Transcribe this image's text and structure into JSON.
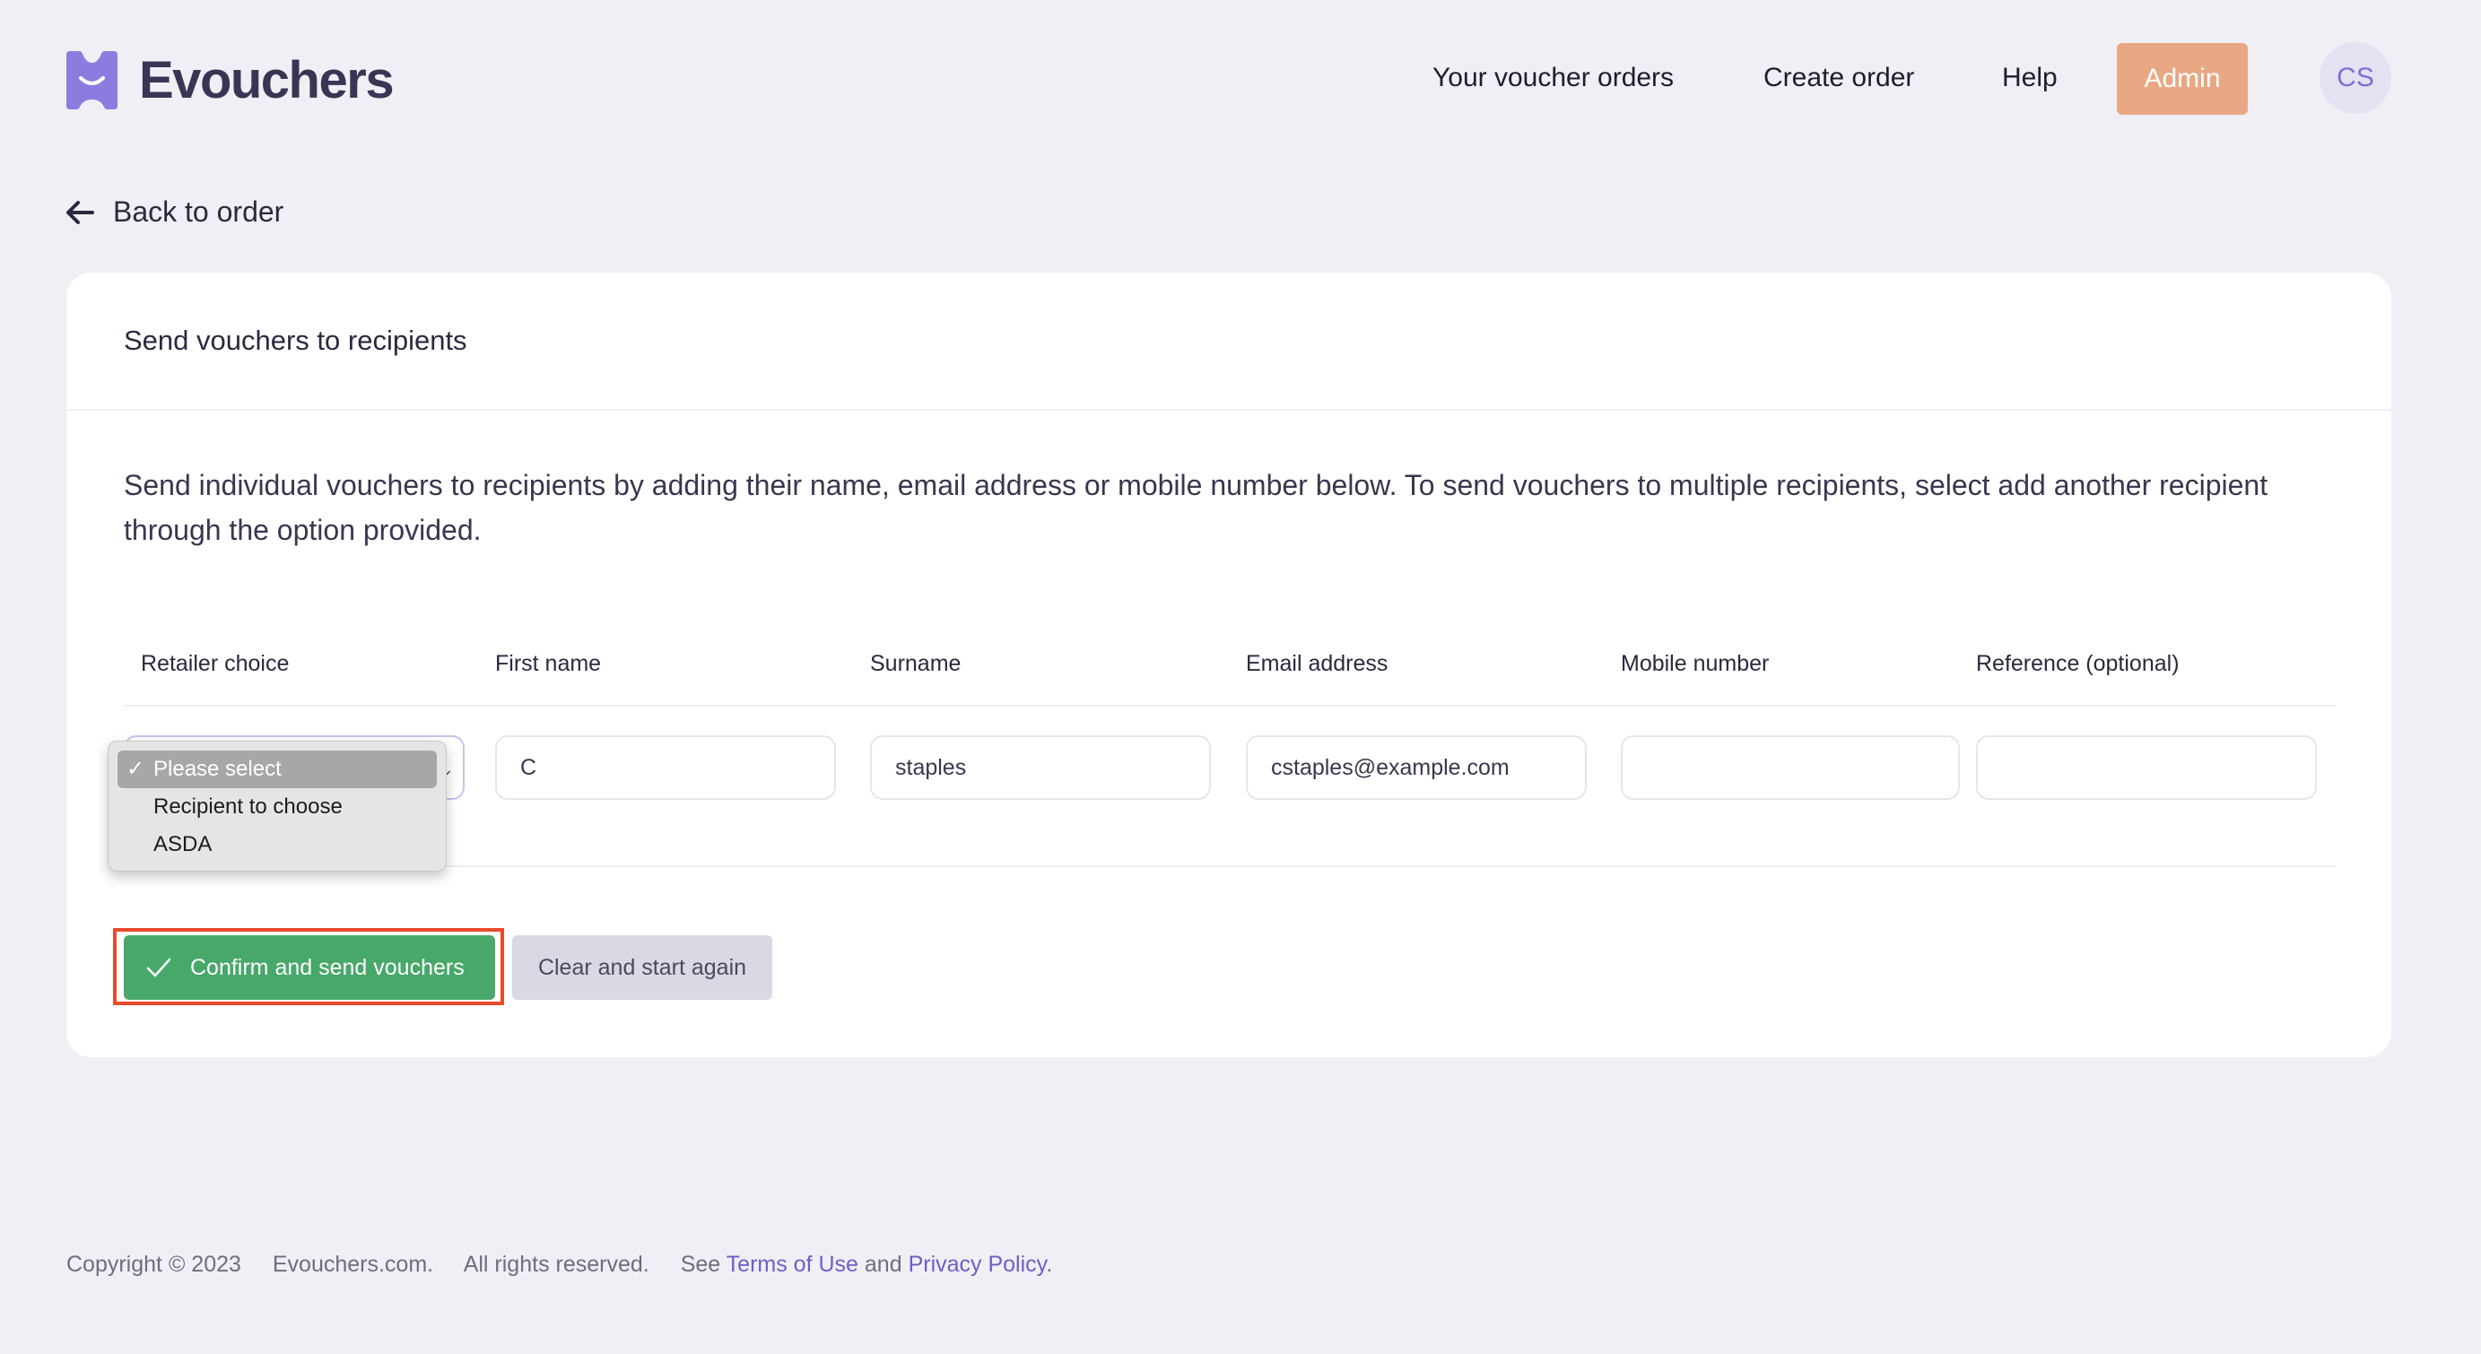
{
  "brand": {
    "name": "Evouchers",
    "color": "#7c6fd1",
    "logo_icon": "evouchers-logo-icon"
  },
  "nav": {
    "orders": "Your voucher orders",
    "create": "Create order",
    "help": "Help",
    "admin": "Admin",
    "avatar_initials": "CS"
  },
  "back": {
    "label": "Back to order",
    "icon": "arrow-left-icon"
  },
  "card": {
    "title": "Send vouchers to recipients",
    "intro": "Send individual vouchers to recipients by adding their name, email address or mobile number below. To send vouchers to multiple recipients, select add another recipient through the option provided."
  },
  "table": {
    "headers": [
      "Retailer choice",
      "First name",
      "Surname",
      "Email address",
      "Mobile number",
      "Reference (optional)"
    ],
    "row": {
      "retailer": "Please select",
      "first_name": "C",
      "surname": "staples",
      "email": "cstaples@example.com",
      "mobile": "",
      "reference": ""
    }
  },
  "dropdown": {
    "options": [
      "Please select",
      "Recipient to choose",
      "ASDA"
    ],
    "selected": "Please select"
  },
  "actions": {
    "confirm": "Confirm and send vouchers",
    "clear": "Clear and start again",
    "confirm_color": "#47a86a",
    "highlight_color": "#e84a2a"
  },
  "footer": {
    "copyright": "Copyright © 2023",
    "site": "Evouchers.com.",
    "rights": "All rights reserved.",
    "see": "See",
    "terms": "Terms of Use",
    "and": "and",
    "privacy": "Privacy Policy",
    "period": "."
  }
}
